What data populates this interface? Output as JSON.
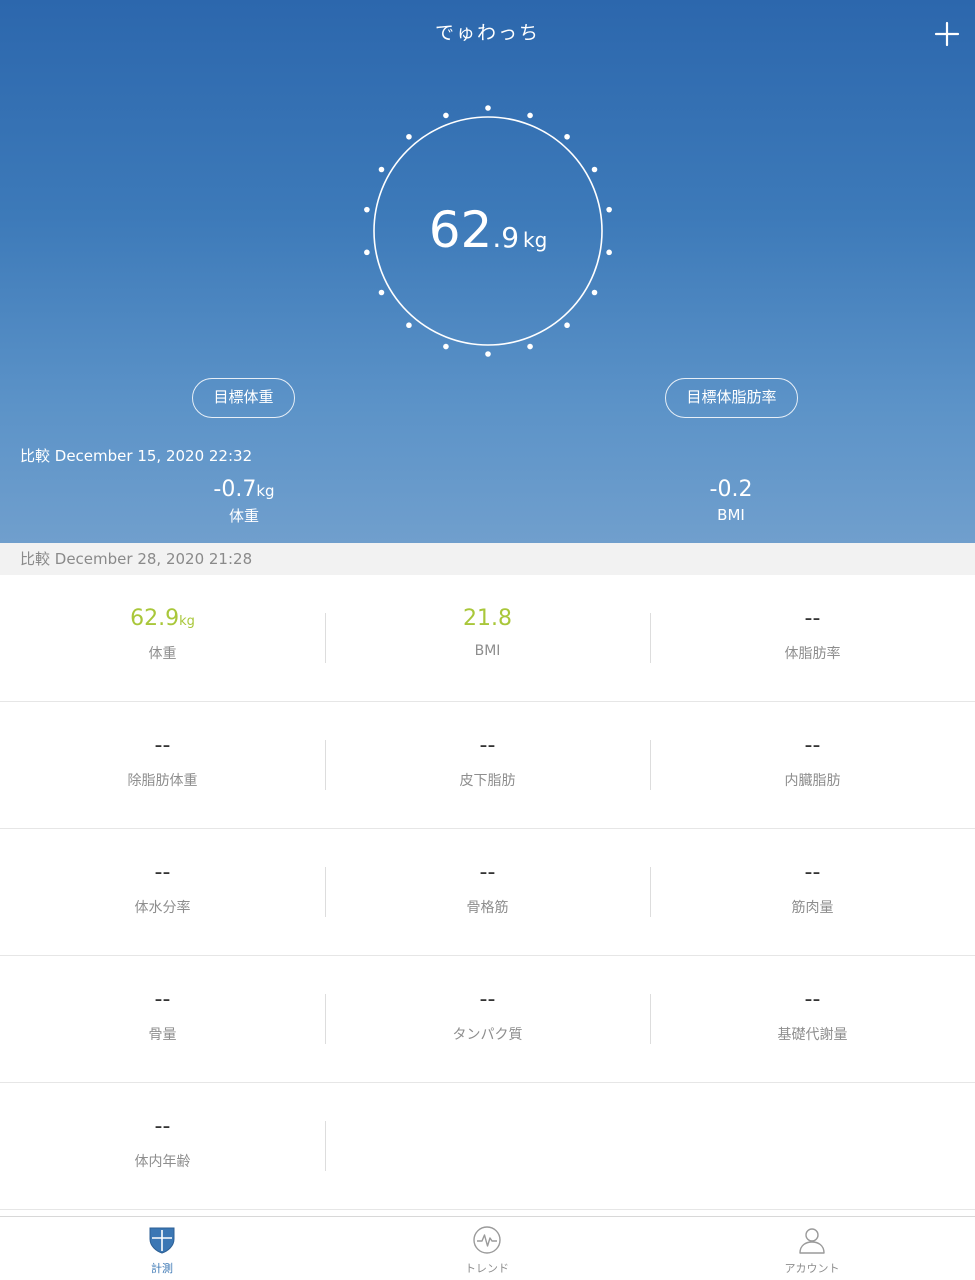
{
  "header": {
    "title": "でゅわっち",
    "add_icon": "plus-icon"
  },
  "current_weight": {
    "integer": "62",
    "decimal": ".9",
    "unit": "kg"
  },
  "goals": {
    "weight_label": "目標体重",
    "body_fat_label": "目標体脂肪率"
  },
  "comparison": {
    "label": "比較 December 15, 2020 22:32",
    "weight_diff": "-0.7",
    "weight_unit": "kg",
    "weight_label": "体重",
    "bmi_diff": "-0.2",
    "bmi_label": "BMI"
  },
  "measurement": {
    "label": "比較 December 28, 2020 21:28"
  },
  "metrics": [
    [
      {
        "value": "62.9",
        "unit": "kg",
        "label": "体重"
      },
      {
        "value": "21.8",
        "unit": "",
        "label": "BMI"
      },
      {
        "value": "--",
        "unit": "",
        "label": "体脂肪率"
      }
    ],
    [
      {
        "value": "--",
        "unit": "",
        "label": "除脂肪体重"
      },
      {
        "value": "--",
        "unit": "",
        "label": "皮下脂肪"
      },
      {
        "value": "--",
        "unit": "",
        "label": "内臓脂肪"
      }
    ],
    [
      {
        "value": "--",
        "unit": "",
        "label": "体水分率"
      },
      {
        "value": "--",
        "unit": "",
        "label": "骨格筋"
      },
      {
        "value": "--",
        "unit": "",
        "label": "筋肉量"
      }
    ],
    [
      {
        "value": "--",
        "unit": "",
        "label": "骨量"
      },
      {
        "value": "--",
        "unit": "",
        "label": "タンパク質"
      },
      {
        "value": "--",
        "unit": "",
        "label": "基礎代謝量"
      }
    ],
    [
      {
        "value": "--",
        "unit": "",
        "label": "体内年齢"
      }
    ]
  ],
  "tabs": [
    {
      "label": "計測",
      "icon": "shield-icon",
      "active": true
    },
    {
      "label": "トレンド",
      "icon": "pulse-icon",
      "active": false
    },
    {
      "label": "アカウント",
      "icon": "person-icon",
      "active": false
    }
  ],
  "colors": {
    "header_gradient_top": "#2c67ad",
    "header_gradient_bottom": "#709fcd",
    "accent_value": "#a9c73a",
    "active_tab": "#3b77b4"
  }
}
